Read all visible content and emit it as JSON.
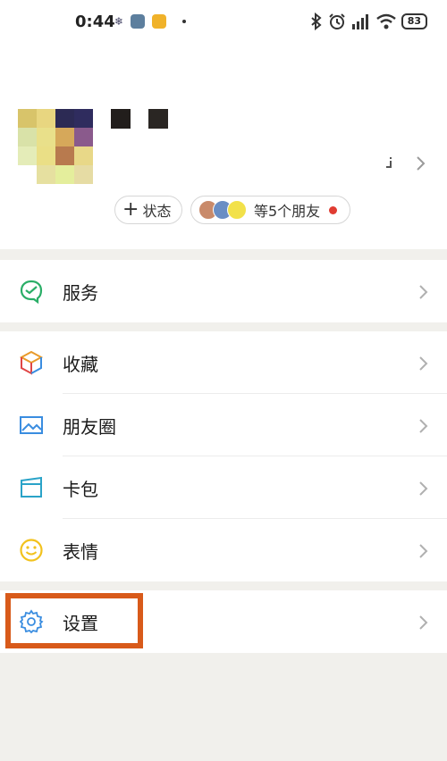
{
  "status_bar": {
    "time": "0:44",
    "battery": "83",
    "left_icons": [
      "snowflake-icon",
      "gear-app-icon",
      "note-app-icon",
      "dot-icon"
    ],
    "right_icons": [
      "bluetooth-icon",
      "alarm-icon",
      "signal-icon",
      "wifi-icon",
      "battery-icon"
    ]
  },
  "profile": {
    "status_button_label": "状态",
    "friends_label": "等5个朋友"
  },
  "menu": {
    "services": "服务",
    "favorites": "收藏",
    "moments": "朋友圈",
    "cards": "卡包",
    "stickers": "表情",
    "settings": "设置"
  },
  "colors": {
    "highlight": "#d85a1a",
    "services_green": "#2aae67",
    "status_dot": "#e03c32"
  }
}
